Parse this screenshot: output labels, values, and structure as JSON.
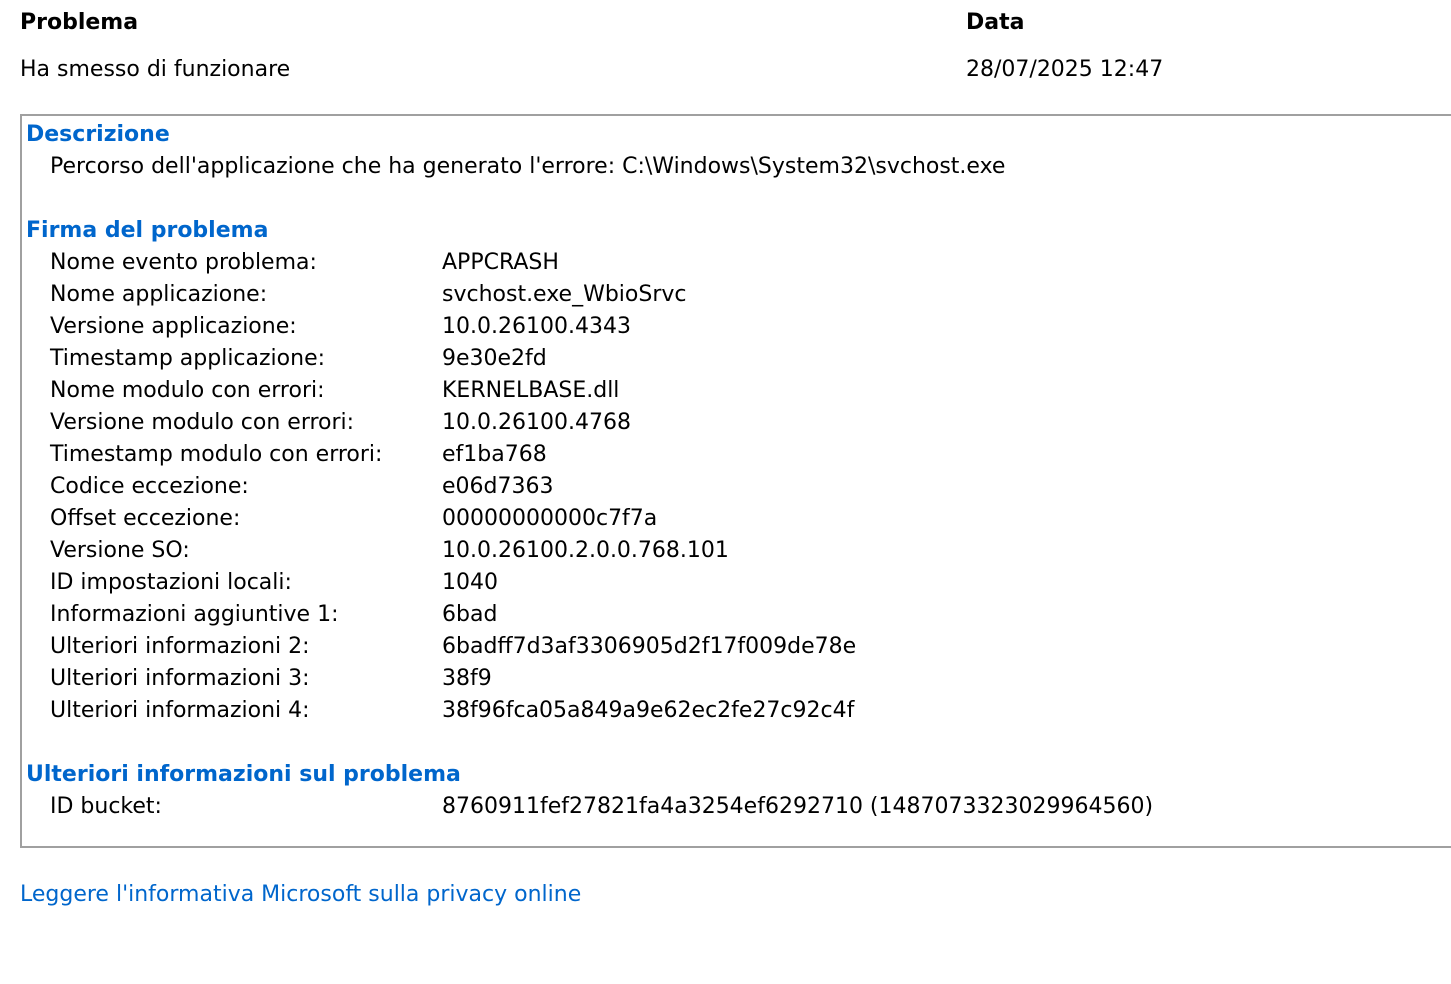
{
  "summary": {
    "problem_header": "Problema",
    "problem_value": "Ha smesso di funzionare",
    "date_header": "Data",
    "date_value": "28/07/2025 12:47"
  },
  "description": {
    "title": "Descrizione",
    "text": "Percorso dell'applicazione che ha generato l'errore: C:\\Windows\\System32\\svchost.exe"
  },
  "signature": {
    "title": "Firma del problema",
    "rows": [
      {
        "key": "Nome evento problema:",
        "value": "APPCRASH"
      },
      {
        "key": "Nome applicazione:",
        "value": "svchost.exe_WbioSrvc"
      },
      {
        "key": "Versione applicazione:",
        "value": "10.0.26100.4343"
      },
      {
        "key": "Timestamp applicazione:",
        "value": "9e30e2fd"
      },
      {
        "key": "Nome modulo con errori:",
        "value": "KERNELBASE.dll"
      },
      {
        "key": "Versione modulo con errori:",
        "value": "10.0.26100.4768"
      },
      {
        "key": "Timestamp modulo con errori:",
        "value": "ef1ba768"
      },
      {
        "key": "Codice eccezione:",
        "value": "e06d7363"
      },
      {
        "key": "Offset eccezione:",
        "value": "00000000000c7f7a"
      },
      {
        "key": "Versione SO:",
        "value": "10.0.26100.2.0.0.768.101"
      },
      {
        "key": "ID impostazioni locali:",
        "value": "1040"
      },
      {
        "key": "Informazioni aggiuntive 1:",
        "value": "6bad"
      },
      {
        "key": "Ulteriori informazioni 2:",
        "value": "6badff7d3af3306905d2f17f009de78e"
      },
      {
        "key": "Ulteriori informazioni 3:",
        "value": "38f9"
      },
      {
        "key": "Ulteriori informazioni 4:",
        "value": "38f96fca05a849a9e62ec2fe27c92c4f"
      }
    ]
  },
  "extra": {
    "title": "Ulteriori informazioni sul problema",
    "rows": [
      {
        "key": "ID bucket:",
        "value": "8760911fef27821fa4a3254ef6292710 (1487073323029964560)"
      }
    ]
  },
  "privacy_link": "Leggere l'informativa Microsoft sulla privacy online",
  "colors": {
    "accent": "#0066cc",
    "border": "#a0a0a0"
  }
}
